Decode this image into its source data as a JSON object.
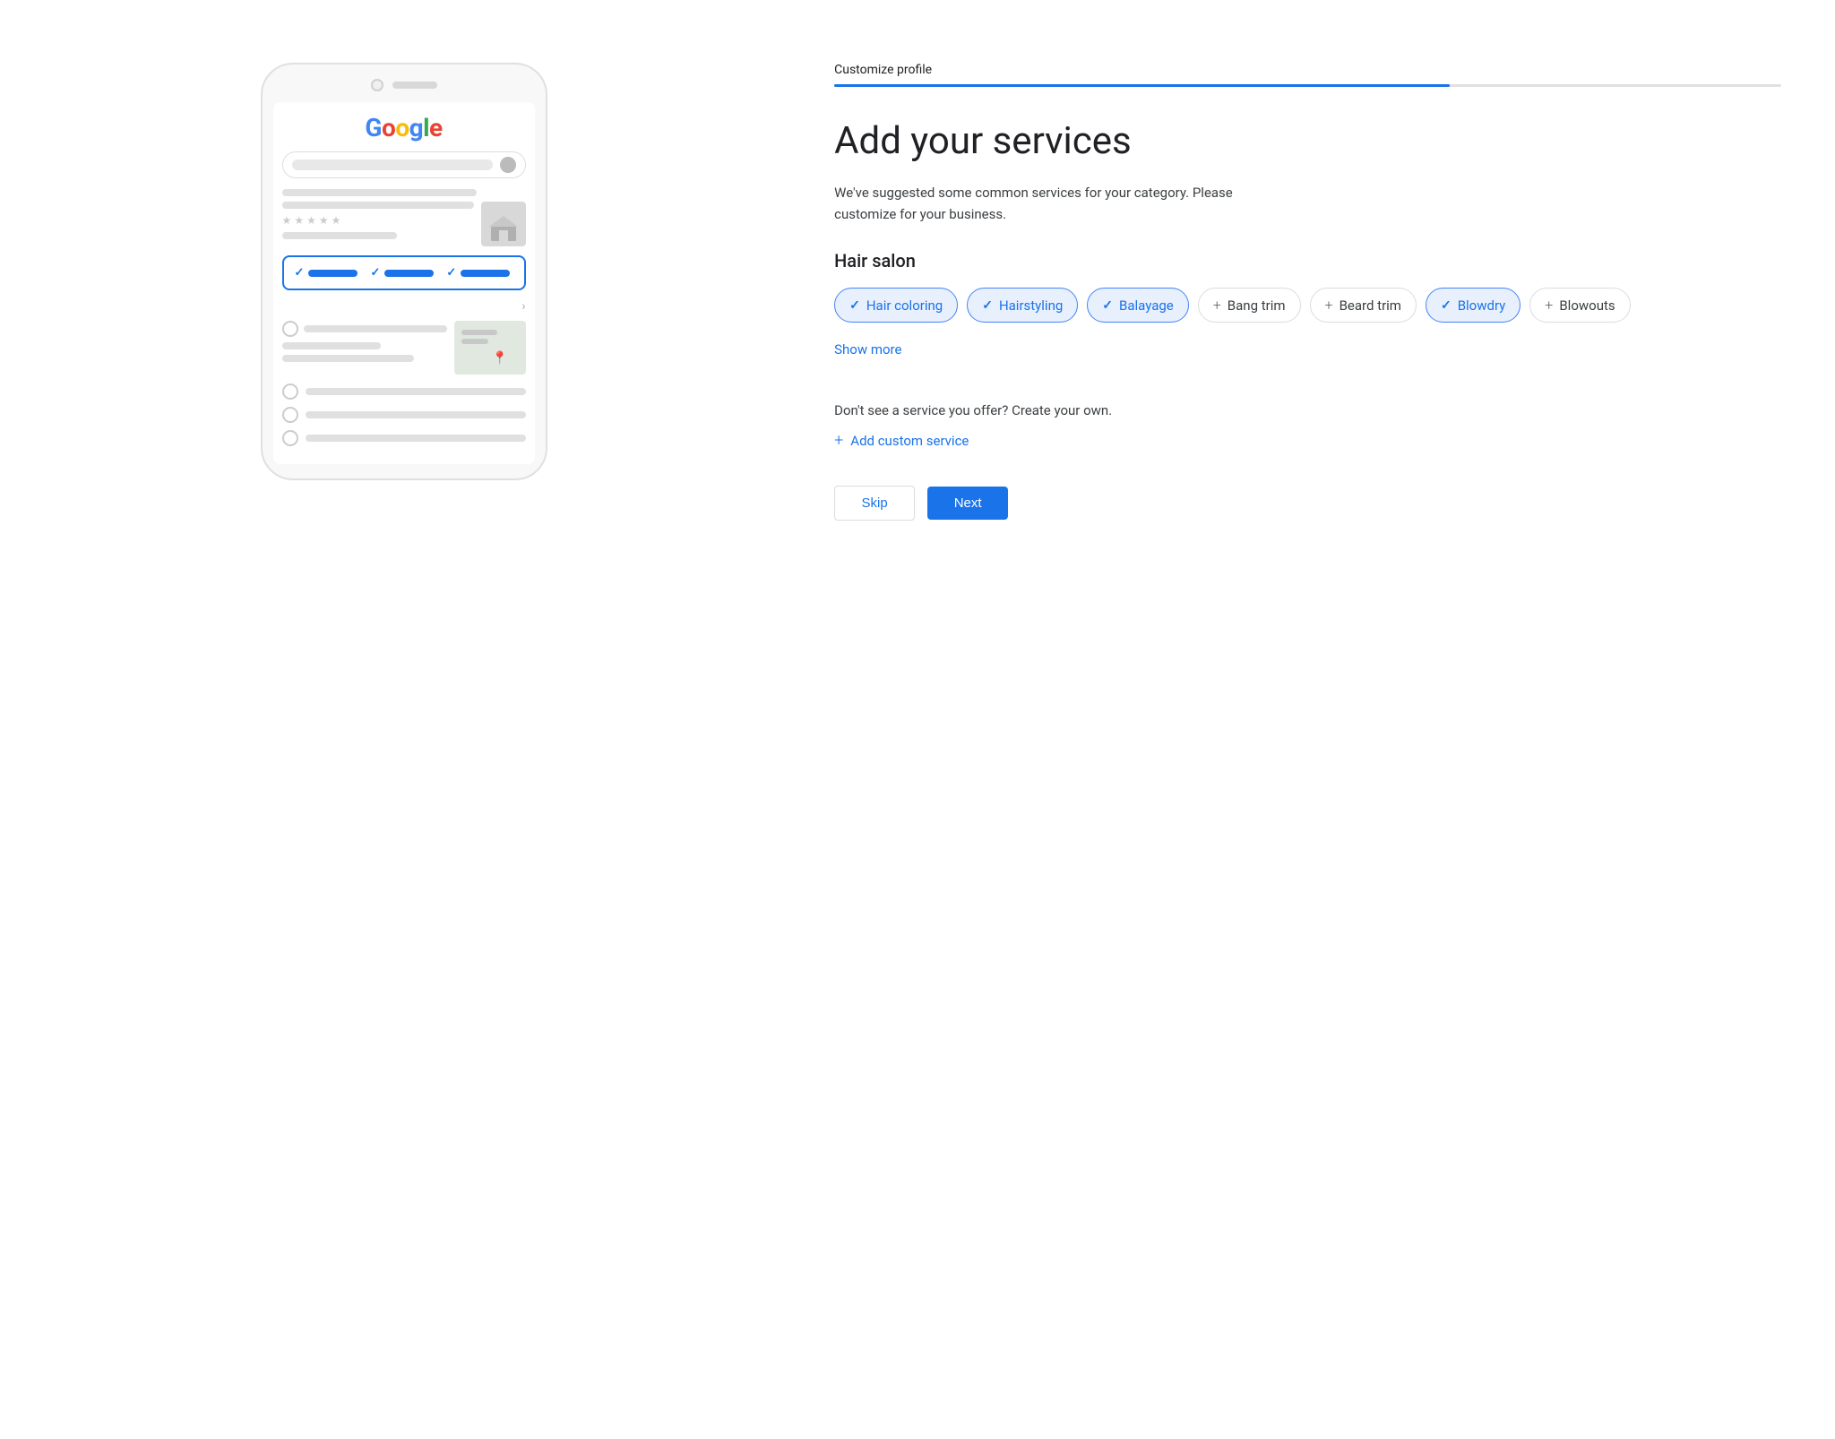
{
  "leftPanel": {
    "googleLetters": [
      "G",
      "o",
      "o",
      "g",
      "l",
      "e"
    ],
    "googleColors": [
      "#4285F4",
      "#EA4335",
      "#FBBC05",
      "#4285F4",
      "#34A853",
      "#EA4335"
    ]
  },
  "progressBar": {
    "label": "Customize profile",
    "fillPercent": 65
  },
  "page": {
    "title": "Add your services",
    "description": "We've suggested some common services for your category. Please customize for your business.",
    "categoryHeading": "Hair salon"
  },
  "services": [
    {
      "id": "hair-coloring",
      "label": "Hair coloring",
      "selected": true
    },
    {
      "id": "hairstyling",
      "label": "Hairstyling",
      "selected": true
    },
    {
      "id": "balayage",
      "label": "Balayage",
      "selected": true
    },
    {
      "id": "bang-trim",
      "label": "Bang trim",
      "selected": false
    },
    {
      "id": "beard-trim",
      "label": "Beard trim",
      "selected": false
    },
    {
      "id": "blowdry",
      "label": "Blowdry",
      "selected": true
    },
    {
      "id": "blowouts",
      "label": "Blowouts",
      "selected": false
    }
  ],
  "showMore": {
    "label": "Show more"
  },
  "customService": {
    "prompt": "Don't see a service you offer? Create your own.",
    "linkLabel": "Add custom service"
  },
  "buttons": {
    "skip": "Skip",
    "next": "Next"
  }
}
